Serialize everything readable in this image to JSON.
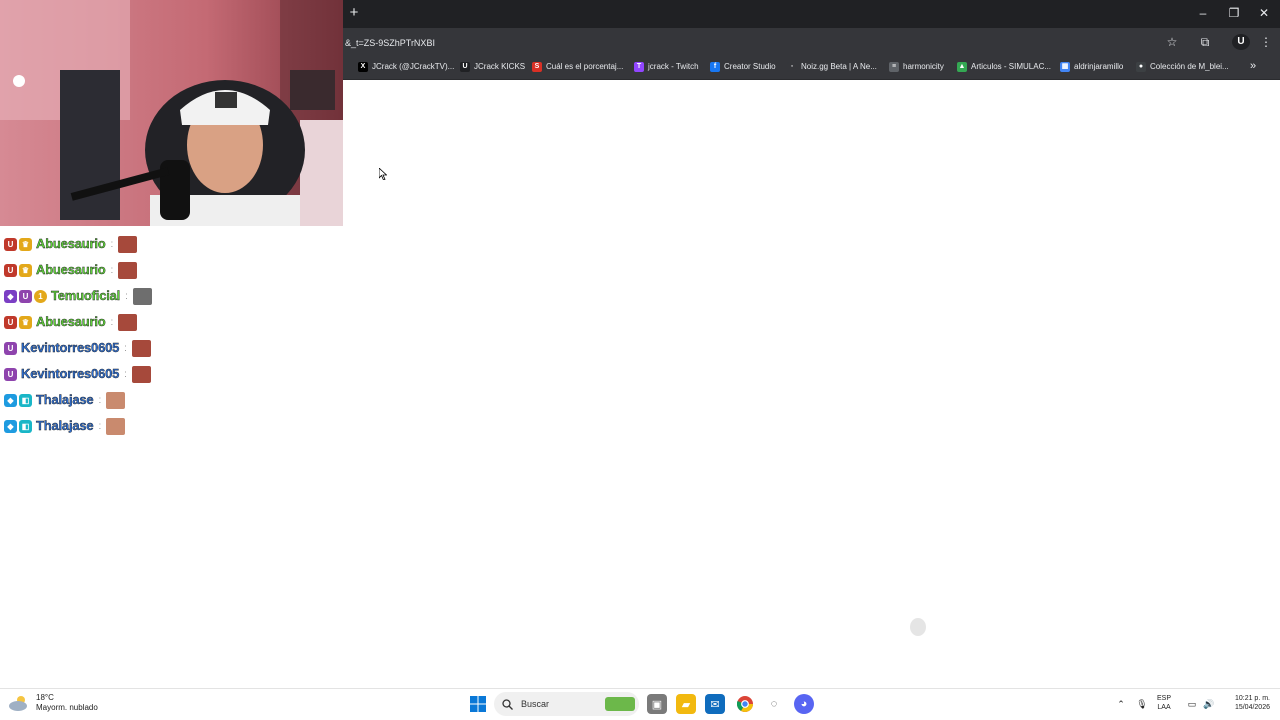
{
  "browser": {
    "new_tab_label": "+",
    "window_controls": {
      "minimize": "–",
      "restore": "❐",
      "close": "✕"
    },
    "url": "&_t=ZS-9SZhPTrNXBI",
    "toolbar_icons": {
      "star": "☆",
      "extensions": "⧉",
      "profile": "U",
      "menu": "⋮"
    },
    "bookmarks": [
      {
        "label": "JCrack (@JCrackTV)...",
        "icon": "x-icon",
        "fav": "X",
        "color": "#000000"
      },
      {
        "label": "JCrack KICKS",
        "icon": "kick-icon",
        "fav": "U",
        "color": "#202124"
      },
      {
        "label": "Cuál es el porcentaj...",
        "icon": "s-icon",
        "fav": "S",
        "color": "#d93025"
      },
      {
        "label": "jcrack - Twitch",
        "icon": "twitch-icon",
        "fav": "T",
        "color": "#9146ff"
      },
      {
        "label": "Creator Studio",
        "icon": "facebook-icon",
        "fav": "f",
        "color": "#1877f2"
      },
      {
        "label": "Noiz.gg Beta | A Ne...",
        "icon": "noiz-icon",
        "fav": "◦",
        "color": "#35363a"
      },
      {
        "label": "harmonicity",
        "icon": "harmonicity-icon",
        "fav": "≡",
        "color": "#5f6368"
      },
      {
        "label": "Articulos - SIMULAC...",
        "icon": "drive-icon",
        "fav": "▲",
        "color": "#34a853"
      },
      {
        "label": "aldrinjaramillo",
        "icon": "calendar-icon",
        "fav": "▦",
        "color": "#4285f4"
      },
      {
        "label": "Colección de M_blei...",
        "icon": "collection-icon",
        "fav": "●",
        "color": "#3c4043"
      }
    ],
    "bookmarks_more": "»"
  },
  "chat": {
    "messages": [
      {
        "user": "Abuesaurio",
        "color": "#5fd33a",
        "badges": [
          {
            "icon": "kick-badge-icon",
            "color": "#c0392b",
            "glyph": "U"
          },
          {
            "icon": "crown-badge-icon",
            "color": "#e3a81a",
            "glyph": "♛"
          }
        ],
        "emote_color": "#a6493b"
      },
      {
        "user": "Abuesaurio",
        "color": "#5fd33a",
        "badges": [
          {
            "icon": "kick-badge-icon",
            "color": "#c0392b",
            "glyph": "U"
          },
          {
            "icon": "crown-badge-icon",
            "color": "#e3a81a",
            "glyph": "♛"
          }
        ],
        "emote_color": "#a6493b"
      },
      {
        "user": "Temuoficial",
        "color": "#5fd33a",
        "badges": [
          {
            "icon": "cube-badge-icon",
            "color": "#7b3fc4",
            "glyph": "◆"
          },
          {
            "icon": "kick-badge-icon",
            "color": "#8e44ad",
            "glyph": "U"
          },
          {
            "icon": "coin-badge-icon",
            "color": "#e3a81a",
            "glyph": "1"
          }
        ],
        "emote_color": "#6e6e6e"
      },
      {
        "user": "Abuesaurio",
        "color": "#5fd33a",
        "badges": [
          {
            "icon": "kick-badge-icon",
            "color": "#c0392b",
            "glyph": "U"
          },
          {
            "icon": "crown-badge-icon",
            "color": "#e3a81a",
            "glyph": "♛"
          }
        ],
        "emote_color": "#a6493b"
      },
      {
        "user": "Kevintorres0605",
        "color": "#2f6fd1",
        "badges": [
          {
            "icon": "kick-badge-icon",
            "color": "#8e44ad",
            "glyph": "U"
          }
        ],
        "emote_color": "#a6493b"
      },
      {
        "user": "Kevintorres0605",
        "color": "#2f6fd1",
        "badges": [
          {
            "icon": "kick-badge-icon",
            "color": "#8e44ad",
            "glyph": "U"
          }
        ],
        "emote_color": "#a6493b"
      },
      {
        "user": "Thalajase",
        "color": "#2f6fd1",
        "badges": [
          {
            "icon": "cube-badge-icon",
            "color": "#1e9be0",
            "glyph": "◆"
          },
          {
            "icon": "sub-badge-icon",
            "color": "#19b6c7",
            "glyph": "◧"
          }
        ],
        "emote_color": "#c98a6e"
      },
      {
        "user": "Thalajase",
        "color": "#2f6fd1",
        "badges": [
          {
            "icon": "cube-badge-icon",
            "color": "#1e9be0",
            "glyph": "◆"
          },
          {
            "icon": "sub-badge-icon",
            "color": "#19b6c7",
            "glyph": "◧"
          }
        ],
        "emote_color": "#c98a6e"
      }
    ],
    "separator": ":"
  },
  "taskbar": {
    "weather": {
      "temp": "18°C",
      "condition": "Mayorm. nublado"
    },
    "search_label": "Buscar",
    "tray_language": {
      "line1": "ESP",
      "line2": "LAA"
    },
    "clock": {
      "time": "10:21 p. m.",
      "date": "15/04/2026"
    },
    "tray_icons": {
      "chevron": "⌃",
      "mic": "🎙",
      "display": "▭",
      "volume": "🔊"
    }
  }
}
